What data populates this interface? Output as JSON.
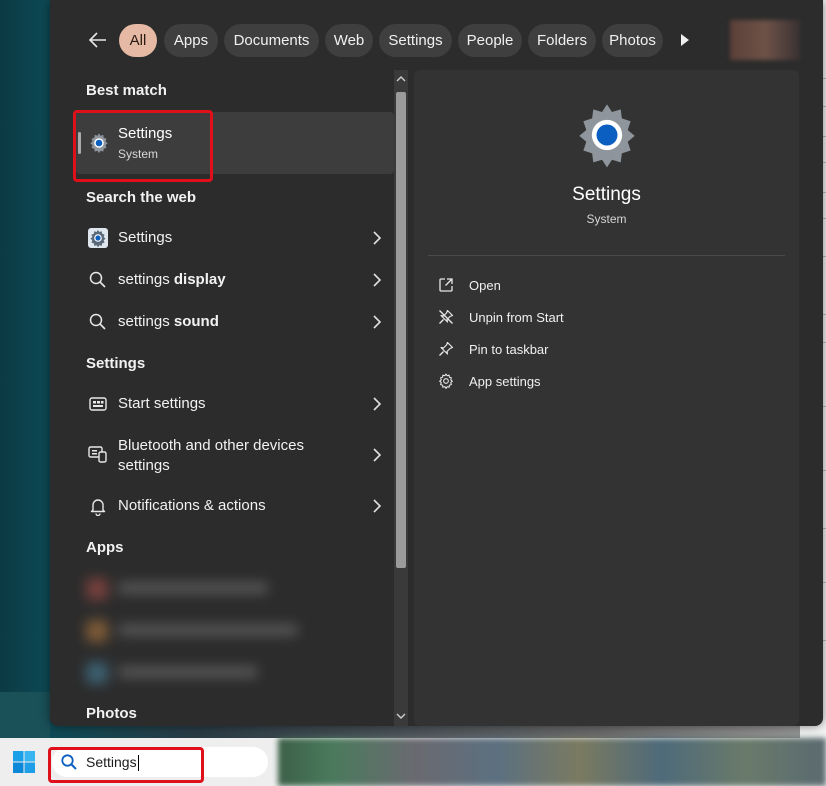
{
  "filters": {
    "tabs": [
      {
        "label": "All",
        "active": true
      },
      {
        "label": "Apps"
      },
      {
        "label": "Documents"
      },
      {
        "label": "Web"
      },
      {
        "label": "Settings"
      },
      {
        "label": "People"
      },
      {
        "label": "Folders"
      },
      {
        "label": "Photos"
      }
    ],
    "back_icon": "arrow-left-icon",
    "more_icon": "play-right-icon"
  },
  "results": {
    "best_match": {
      "title": "Best match",
      "item": {
        "name": "Settings",
        "sub": "System",
        "icon": "settings-gear-icon"
      }
    },
    "web": {
      "title": "Search the web",
      "items": [
        {
          "prefix": "Settings",
          "bold": "",
          "icon": "settings-app-icon"
        },
        {
          "prefix": "settings ",
          "bold": "display",
          "icon": "search-icon"
        },
        {
          "prefix": "settings ",
          "bold": "sound",
          "icon": "search-icon"
        }
      ]
    },
    "settings": {
      "title": "Settings",
      "items": [
        {
          "label": "Start settings",
          "icon": "start-menu-icon"
        },
        {
          "label": "Bluetooth and other devices settings",
          "line1": "Bluetooth and other devices",
          "line2": "settings",
          "icon": "devices-icon"
        },
        {
          "label": "Notifications & actions",
          "icon": "bell-icon"
        }
      ]
    },
    "apps": {
      "title": "Apps"
    },
    "photos": {
      "title": "Photos"
    }
  },
  "preview": {
    "title": "Settings",
    "subtitle": "System",
    "actions": [
      {
        "label": "Open",
        "icon": "open-external-icon"
      },
      {
        "label": "Unpin from Start",
        "icon": "unpin-icon"
      },
      {
        "label": "Pin to taskbar",
        "icon": "pin-icon"
      },
      {
        "label": "App settings",
        "icon": "gear-icon"
      }
    ]
  },
  "taskbar": {
    "search_value": "Settings",
    "search_icon": "search-icon",
    "start_icon": "windows-logo-icon"
  },
  "colors": {
    "accent_chip": "#e5b9a3",
    "highlight": "#e0101a",
    "settings_blue": "#0a5fc0"
  }
}
